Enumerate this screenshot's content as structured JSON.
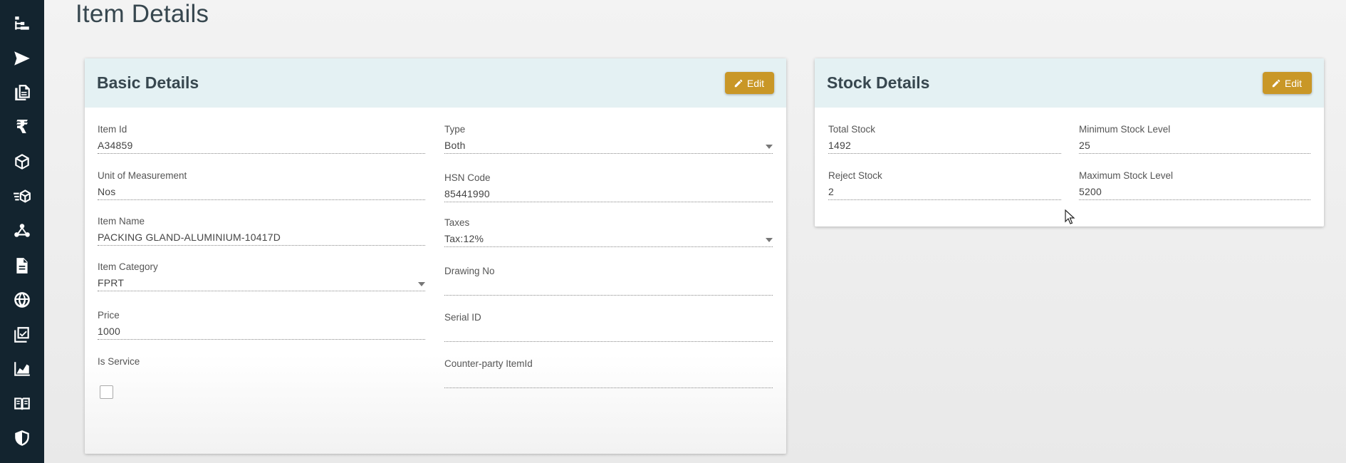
{
  "page": {
    "title": "Item Details"
  },
  "sidebar": {
    "items": [
      {
        "name": "hierarchy-icon"
      },
      {
        "name": "send-icon"
      },
      {
        "name": "documents-icon"
      },
      {
        "name": "rupee-icon",
        "glyph": "₹"
      },
      {
        "name": "cube-icon"
      },
      {
        "name": "fast-delivery-icon"
      },
      {
        "name": "webhook-icon"
      },
      {
        "name": "file-icon"
      },
      {
        "name": "globe-icon"
      },
      {
        "name": "checklist-icon"
      },
      {
        "name": "chart-icon"
      },
      {
        "name": "book-icon"
      },
      {
        "name": "shield-icon"
      }
    ]
  },
  "basic": {
    "title": "Basic Details",
    "edit_label": "Edit",
    "item_id": {
      "label": "Item Id",
      "value": "A34859"
    },
    "type": {
      "label": "Type",
      "value": "Both"
    },
    "uom": {
      "label": "Unit of Measurement",
      "value": "Nos"
    },
    "hsn": {
      "label": "HSN Code",
      "value": "85441990"
    },
    "item_name": {
      "label": "Item Name",
      "value": "PACKING GLAND-ALUMINIUM-10417D"
    },
    "taxes": {
      "label": "Taxes",
      "value": "Tax:12%"
    },
    "category": {
      "label": "Item Category",
      "value": "FPRT"
    },
    "drawing": {
      "label": "Drawing No",
      "value": ""
    },
    "price": {
      "label": "Price",
      "value": "1000"
    },
    "serial": {
      "label": "Serial ID",
      "value": ""
    },
    "is_service": {
      "label": "Is Service",
      "checked": false
    },
    "counter_party": {
      "label": "Counter-party ItemId",
      "value": ""
    }
  },
  "stock": {
    "title": "Stock Details",
    "edit_label": "Edit",
    "total": {
      "label": "Total Stock",
      "value": "1492"
    },
    "min": {
      "label": "Minimum Stock Level",
      "value": "25"
    },
    "reject": {
      "label": "Reject Stock",
      "value": "2"
    },
    "max": {
      "label": "Maximum Stock Level",
      "value": "5200"
    }
  },
  "colors": {
    "accent": "#c99727",
    "sidebar": "#13242f",
    "header": "#e4f1f3"
  }
}
